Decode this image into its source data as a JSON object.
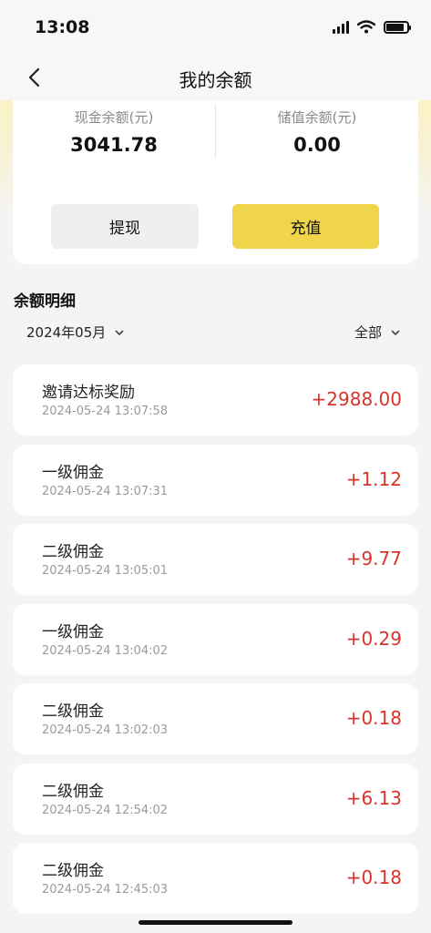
{
  "status_bar": {
    "time": "13:08"
  },
  "nav": {
    "title": "我的余额",
    "back_icon": "chevron-left-icon"
  },
  "balance": {
    "cash_label": "现金余额(元)",
    "cash_value": "3041.78",
    "stored_label": "储值余额(元)",
    "stored_value": "0.00",
    "withdraw_label": "提现",
    "recharge_label": "充值",
    "accent_color": "#f0d54a"
  },
  "detail": {
    "title": "余额明细",
    "month_filter": "2024年05月",
    "type_filter": "全部",
    "amount_color": "#d8342c",
    "transactions": [
      {
        "name": "邀请达标奖励",
        "time": "2024-05-24 13:07:58",
        "amount": "+2988.00"
      },
      {
        "name": "一级佣金",
        "time": "2024-05-24 13:07:31",
        "amount": "+1.12"
      },
      {
        "name": "二级佣金",
        "time": "2024-05-24 13:05:01",
        "amount": "+9.77"
      },
      {
        "name": "一级佣金",
        "time": "2024-05-24 13:04:02",
        "amount": "+0.29"
      },
      {
        "name": "二级佣金",
        "time": "2024-05-24 13:02:03",
        "amount": "+0.18"
      },
      {
        "name": "二级佣金",
        "time": "2024-05-24 12:54:02",
        "amount": "+6.13"
      },
      {
        "name": "二级佣金",
        "time": "2024-05-24 12:45:03",
        "amount": "+0.18"
      }
    ]
  }
}
